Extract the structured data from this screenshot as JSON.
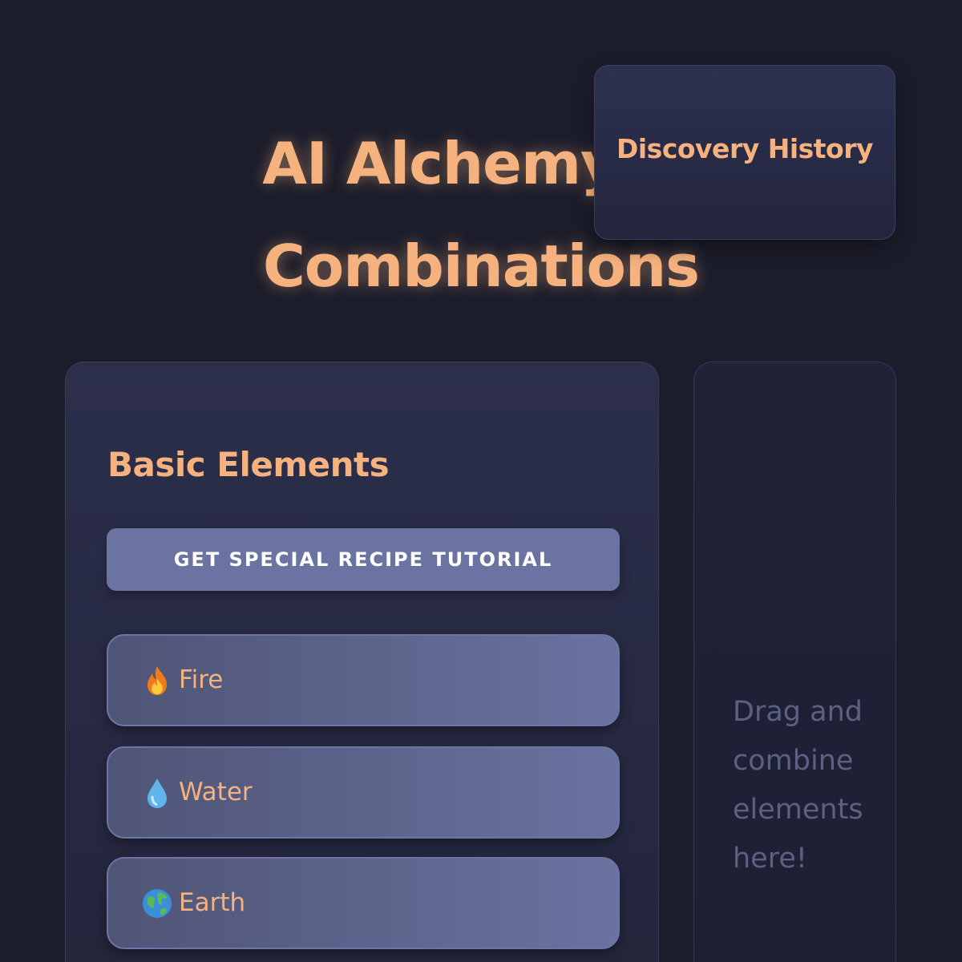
{
  "header": {
    "title_line1": "AI Alchemy - I",
    "title_line2": "Combinations"
  },
  "history": {
    "button_label": "Discovery History"
  },
  "elements_panel": {
    "heading": "Basic Elements",
    "tutorial_button_label": "GET SPECIAL RECIPE TUTORIAL",
    "items": [
      {
        "label": "Fire",
        "icon": "fire-icon"
      },
      {
        "label": "Water",
        "icon": "water-drop-icon"
      },
      {
        "label": "Earth",
        "icon": "earth-globe-icon"
      }
    ]
  },
  "combine_area": {
    "hint": "Drag and combine elements here!"
  },
  "colors": {
    "accent": "#f5b27e",
    "background": "#1c1d2b",
    "panel": "#2c2f4b",
    "tutorial_button": "#6a73a2",
    "hint_text": "#5d6080"
  }
}
